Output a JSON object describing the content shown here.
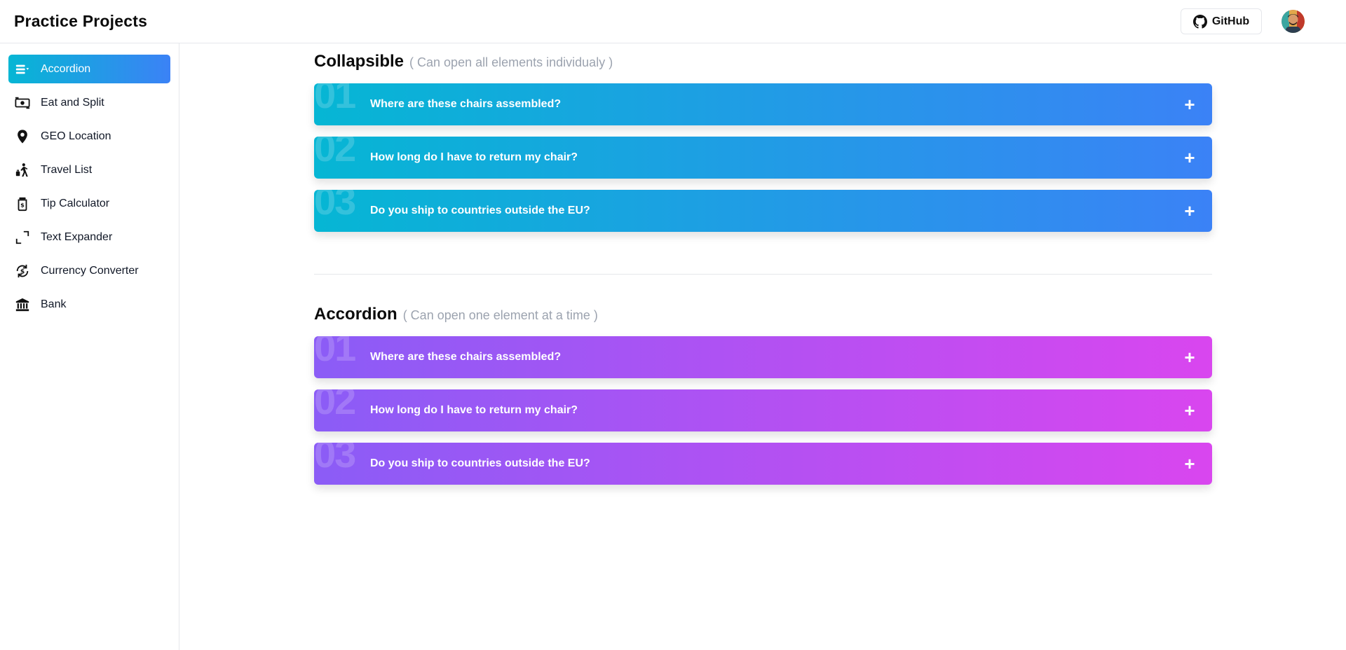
{
  "app": {
    "title": "Practice Projects"
  },
  "header": {
    "github_label": "GitHub"
  },
  "sidebar": {
    "items": [
      {
        "label": "Accordion",
        "icon": "accordion-icon",
        "active": true
      },
      {
        "label": "Eat and Split",
        "icon": "money-icon"
      },
      {
        "label": "GEO Location",
        "icon": "map-pin-icon"
      },
      {
        "label": "Travel List",
        "icon": "traveler-icon"
      },
      {
        "label": "Tip Calculator",
        "icon": "tip-jar-icon"
      },
      {
        "label": "Text Expander",
        "icon": "expand-icon"
      },
      {
        "label": "Currency Converter",
        "icon": "currency-exchange-icon"
      },
      {
        "label": "Bank",
        "icon": "bank-icon"
      }
    ]
  },
  "collapsible": {
    "title": "Collapsible",
    "subtitle": "( Can open all elements individualy )",
    "items": [
      {
        "num": "01",
        "question": "Where are these chairs assembled?",
        "toggle": "+"
      },
      {
        "num": "02",
        "question": "How long do I have to return my chair?",
        "toggle": "+"
      },
      {
        "num": "03",
        "question": "Do you ship to countries outside the EU?",
        "toggle": "+"
      }
    ]
  },
  "accordion": {
    "title": "Accordion",
    "subtitle": "( Can open one element at a time )",
    "items": [
      {
        "num": "01",
        "question": "Where are these chairs assembled?",
        "toggle": "+"
      },
      {
        "num": "02",
        "question": "How long do I have to return my chair?",
        "toggle": "+"
      },
      {
        "num": "03",
        "question": "Do you ship to countries outside the EU?",
        "toggle": "+"
      }
    ]
  },
  "colors": {
    "collapsible_gradient": [
      "#06b6d4",
      "#3b82f6"
    ],
    "accordion_gradient": [
      "#8b5cf6",
      "#d946ef"
    ]
  }
}
